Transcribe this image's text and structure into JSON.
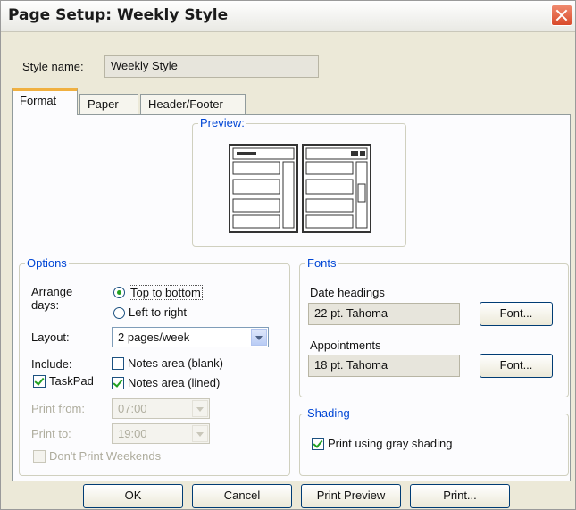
{
  "window": {
    "title": "Page Setup: Weekly Style"
  },
  "style_name": {
    "label": "Style name:",
    "value": "Weekly Style"
  },
  "tabs": [
    {
      "label": "Format"
    },
    {
      "label": "Paper"
    },
    {
      "label": "Header/Footer"
    }
  ],
  "preview": {
    "label": "Preview:"
  },
  "options": {
    "title": "Options",
    "arrange_label_1": "Arrange",
    "arrange_label_2": "days:",
    "radio_top": "Top to bottom",
    "radio_left": "Left to right",
    "layout_label": "Layout:",
    "layout_value": "2 pages/week",
    "include_label": "Include:",
    "notes_blank": "Notes area (blank)",
    "taskpad": "TaskPad",
    "notes_lined": "Notes area (lined)",
    "print_from_label": "Print from:",
    "print_from_value": "07:00",
    "print_to_label": "Print to:",
    "print_to_value": "19:00",
    "dont_print_weekends": "Don't Print Weekends"
  },
  "fonts": {
    "title": "Fonts",
    "date_headings_label": "Date headings",
    "date_headings_value": "22 pt. Tahoma",
    "font_button_1": "Font...",
    "appointments_label": "Appointments",
    "appointments_value": "18 pt. Tahoma",
    "font_button_2": "Font..."
  },
  "shading": {
    "title": "Shading",
    "print_gray": "Print using gray shading"
  },
  "buttons": {
    "ok": "OK",
    "cancel": "Cancel",
    "print_preview": "Print Preview",
    "print": "Print..."
  }
}
